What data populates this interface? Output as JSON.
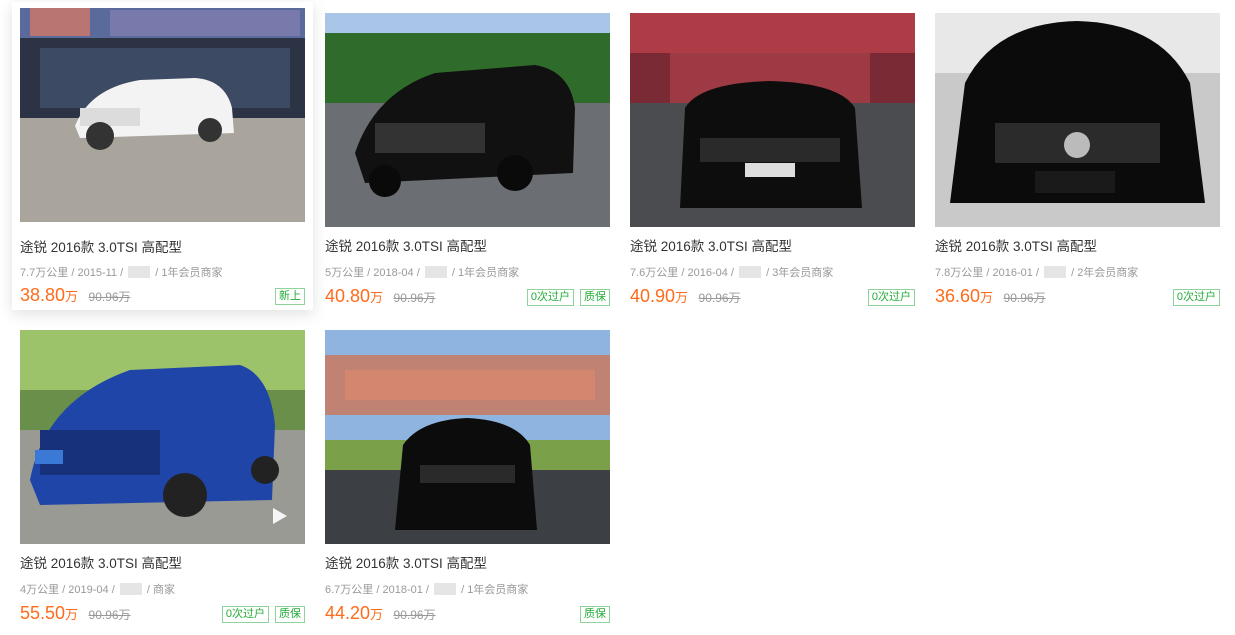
{
  "listings": [
    {
      "title": "途锐 2016款 3.0TSI 高配型",
      "mileage": "7.7万公里",
      "date": "2015-11",
      "seller": "1年会员商家",
      "price": "38.80",
      "unit": "万",
      "original": "90.96万",
      "tags": [
        "新上"
      ],
      "image": "white-touareg-showroom-icon"
    },
    {
      "title": "途锐 2016款 3.0TSI 高配型",
      "mileage": "5万公里",
      "date": "2018-04",
      "seller": "1年会员商家",
      "price": "40.80",
      "unit": "万",
      "original": "90.96万",
      "tags": [
        "0次过户",
        "质保"
      ],
      "image": "black-touareg-road-icon"
    },
    {
      "title": "途锐 2016款 3.0TSI 高配型",
      "mileage": "7.6万公里",
      "date": "2016-04",
      "seller": "3年会员商家",
      "price": "40.90",
      "unit": "万",
      "original": "90.96万",
      "tags": [
        "0次过户"
      ],
      "image": "black-touareg-lot-icon"
    },
    {
      "title": "途锐 2016款 3.0TSI 高配型",
      "mileage": "7.8万公里",
      "date": "2016-01",
      "seller": "2年会员商家",
      "price": "36.60",
      "unit": "万",
      "original": "90.96万",
      "tags": [
        "0次过户"
      ],
      "image": "black-touareg-front-icon"
    },
    {
      "title": "途锐 2016款 3.0TSI 高配型",
      "mileage": "4万公里",
      "date": "2019-04",
      "seller": "商家",
      "price": "55.50",
      "unit": "万",
      "original": "90.96万",
      "tags": [
        "0次过户",
        "质保"
      ],
      "image": "blue-touareg-street-icon"
    },
    {
      "title": "途锐 2016款 3.0TSI 高配型",
      "mileage": "6.7万公里",
      "date": "2018-01",
      "seller": "1年会员商家",
      "price": "44.20",
      "unit": "万",
      "original": "90.96万",
      "tags": [
        "质保"
      ],
      "image": "black-touareg-park-icon"
    }
  ],
  "colors": {
    "price": "#ff6b1a",
    "tag": "#22ac38"
  }
}
